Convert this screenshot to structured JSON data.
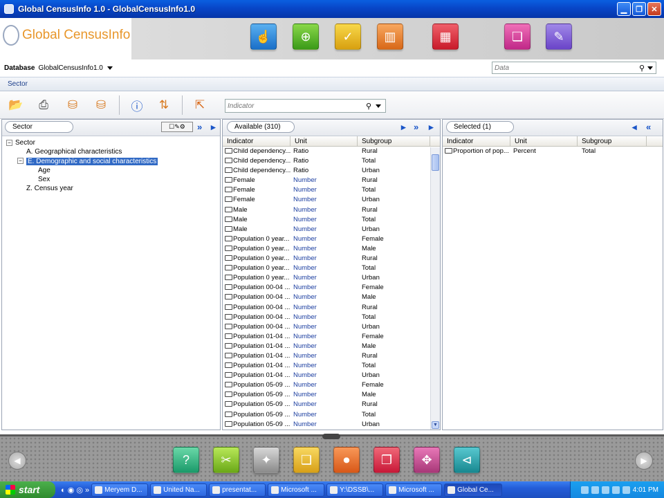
{
  "window": {
    "title": "Global CensusInfo 1.0 - GlobalCensusInfo1.0"
  },
  "header": {
    "logo_text": "Global CensusInfo"
  },
  "database": {
    "label": "Database",
    "value": "GlobalCensusInfo1.0",
    "search_placeholder": "Data"
  },
  "sector_tab": {
    "label": "Sector"
  },
  "indicator_search": {
    "placeholder": "Indicator"
  },
  "sector_panel": {
    "pill": "Sector",
    "tree": [
      {
        "label": "Sector",
        "level": 0,
        "box": "⊟"
      },
      {
        "label": "A. Geographical characteristics",
        "level": 1
      },
      {
        "label": "E. Demographic and social characteristics",
        "level": 1,
        "box": "⊟",
        "selected": true
      },
      {
        "label": "Age",
        "level": 2
      },
      {
        "label": "Sex",
        "level": 2
      },
      {
        "label": "Z. Census year",
        "level": 1
      }
    ]
  },
  "available_panel": {
    "pill": "Available (310)",
    "columns": [
      "Indicator",
      "Unit",
      "Subgroup"
    ],
    "rows": [
      [
        "Child dependency...",
        "Ratio",
        "Rural"
      ],
      [
        "Child dependency...",
        "Ratio",
        "Total"
      ],
      [
        "Child dependency...",
        "Ratio",
        "Urban"
      ],
      [
        "Female",
        "Number",
        "Rural"
      ],
      [
        "Female",
        "Number",
        "Total"
      ],
      [
        "Female",
        "Number",
        "Urban"
      ],
      [
        "Male",
        "Number",
        "Rural"
      ],
      [
        "Male",
        "Number",
        "Total"
      ],
      [
        "Male",
        "Number",
        "Urban"
      ],
      [
        "Population 0 year...",
        "Number",
        "Female"
      ],
      [
        "Population 0 year...",
        "Number",
        "Male"
      ],
      [
        "Population 0 year...",
        "Number",
        "Rural"
      ],
      [
        "Population 0 year...",
        "Number",
        "Total"
      ],
      [
        "Population 0 year...",
        "Number",
        "Urban"
      ],
      [
        "Population 00-04 ...",
        "Number",
        "Female"
      ],
      [
        "Population 00-04 ...",
        "Number",
        "Male"
      ],
      [
        "Population 00-04 ...",
        "Number",
        "Rural"
      ],
      [
        "Population 00-04 ...",
        "Number",
        "Total"
      ],
      [
        "Population 00-04 ...",
        "Number",
        "Urban"
      ],
      [
        "Population 01-04 ...",
        "Number",
        "Female"
      ],
      [
        "Population 01-04 ...",
        "Number",
        "Male"
      ],
      [
        "Population 01-04 ...",
        "Number",
        "Rural"
      ],
      [
        "Population 01-04 ...",
        "Number",
        "Total"
      ],
      [
        "Population 01-04 ...",
        "Number",
        "Urban"
      ],
      [
        "Population 05-09 ...",
        "Number",
        "Female"
      ],
      [
        "Population 05-09 ...",
        "Number",
        "Male"
      ],
      [
        "Population 05-09 ...",
        "Number",
        "Rural"
      ],
      [
        "Population 05-09 ...",
        "Number",
        "Total"
      ],
      [
        "Population 05-09 ...",
        "Number",
        "Urban"
      ]
    ]
  },
  "selected_panel": {
    "pill": "Selected (1)",
    "columns": [
      "Indicator",
      "Unit",
      "Subgroup"
    ],
    "rows": [
      [
        "Proportion of pop...",
        "Percent",
        "Total"
      ]
    ]
  },
  "taskbar": {
    "start": "start",
    "tasks": [
      {
        "label": "Meryem D...",
        "active": false
      },
      {
        "label": "United Na...",
        "active": false
      },
      {
        "label": "presentat...",
        "active": false
      },
      {
        "label": "Microsoft ...",
        "active": false
      },
      {
        "label": "Y:\\DSSB\\...",
        "active": false
      },
      {
        "label": "Microsoft ...",
        "active": false
      },
      {
        "label": "Global Ce...",
        "active": true
      }
    ],
    "clock": "4:01 PM"
  },
  "colors": {
    "accent": "#316ac5",
    "titlebar": "#0846c8",
    "unit_number": "#1a3da0"
  }
}
